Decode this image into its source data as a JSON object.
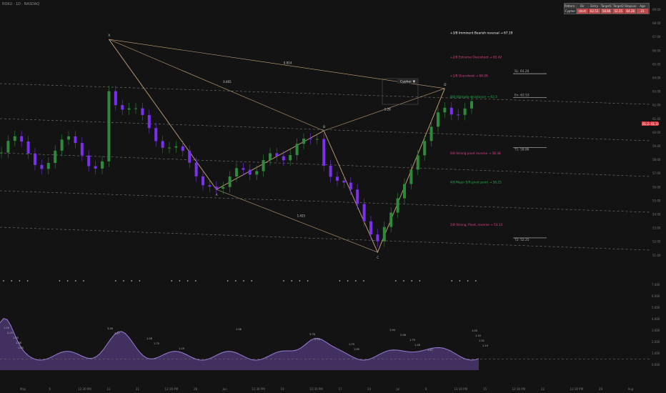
{
  "ticker": "ROKU · 1D · NASDAQ",
  "pattern": {
    "name": "Cypher ▼",
    "points": [
      {
        "label": "X",
        "day": 16,
        "price": 66.8
      },
      {
        "label": "A",
        "day": 32,
        "price": 55.8
      },
      {
        "label": "B",
        "day": 48,
        "price": 60.1
      },
      {
        "label": "C",
        "day": 56,
        "price": 51.2
      },
      {
        "label": "D",
        "day": 66,
        "price": 63.2
      }
    ],
    "ratios": [
      {
        "label": "0.465",
        "day": 33,
        "price": 63.6
      },
      {
        "label": "1.28",
        "day": 57,
        "price": 61.6
      },
      {
        "label": "0.814",
        "day": 42,
        "price": 65.0
      },
      {
        "label": "1.425",
        "day": 44,
        "price": 53.8
      }
    ]
  },
  "murrey_levels": [
    {
      "label": "+3/8 Imminent Bearish reversal  →  67.19",
      "price": 67.19,
      "color": "#ffffff"
    },
    {
      "label": "+2/8 Extreme Overshoot  →  65.42",
      "price": 65.42,
      "color": "#e0408a"
    },
    {
      "label": "+1/8 Overshoot  →  64.06",
      "price": 64.06,
      "color": "#e0408a"
    },
    {
      "label": "8/8 Ultimate resistance  →  62.5",
      "price": 62.5,
      "color": "#22b04a"
    },
    {
      "label": "6/8 Strong pivot reverse  →  58.38",
      "price": 58.38,
      "color": "#e0408a"
    },
    {
      "label": "4/8 Major S/R pivot point  →  56.25",
      "price": 56.25,
      "color": "#22b04a"
    },
    {
      "label": "2/8 Strong, Pivot, reverse  →  53.13",
      "price": 53.13,
      "color": "#e0408a"
    }
  ],
  "targets": [
    {
      "label": "SL: 64.28",
      "price": 64.28,
      "color": "#aaaaaa"
    },
    {
      "label": "En: 62.53",
      "price": 62.53,
      "color": "#aaaaaa"
    },
    {
      "label": "T1: 58.86",
      "price": 58.86,
      "color": "#aaaaaa"
    },
    {
      "label": "T2: 52.25",
      "price": 52.25,
      "color": "#aaaaaa"
    }
  ],
  "table": {
    "headers": [
      "Pattern Name",
      "Dir",
      "Entry",
      "Target1",
      "Target2",
      "StopLoss",
      "Age"
    ],
    "row": [
      "Cypher",
      "short",
      "62.53",
      "58.86",
      "52.25",
      "64.28",
      "21"
    ]
  },
  "price_badge": "61.21",
  "price_badge2": "61.33",
  "price_axis": [
    "69.00",
    "68.00",
    "67.00",
    "66.00",
    "65.00",
    "64.00",
    "63.00",
    "62.00",
    "61.00",
    "60.00",
    "59.00",
    "58.00",
    "57.00",
    "56.00",
    "55.00",
    "54.00",
    "53.00",
    "52.00",
    "51.00"
  ],
  "osc_axis": [
    "7.000",
    "6.000",
    "5.000",
    "4.000",
    "3.000",
    "2.000",
    "1.000",
    "0.000"
  ],
  "x_axis": [
    "May",
    "6",
    "12:30 PM",
    "13",
    "21",
    "12:30 PM",
    "28",
    "Jun",
    "12:30 PM",
    "10",
    "12:30 PM",
    "17",
    "24",
    "Jul",
    "8",
    "12:30 PM",
    "15",
    "12:30 PM",
    "22",
    "12:30 PM",
    "29",
    "Aug"
  ],
  "osc_labels": [
    "1.19",
    "2.25",
    "1.85",
    "1.88",
    "1.85",
    "3.26",
    "3.27",
    "1.28",
    "1.75",
    "1.19",
    "1.58",
    "3.78",
    "2.14",
    "1.79",
    "1.95",
    "1.94",
    "2.56",
    "1.79",
    "1.28",
    "1.87",
    "1.00",
    "1.10",
    "1.92",
    "1.19"
  ]
}
